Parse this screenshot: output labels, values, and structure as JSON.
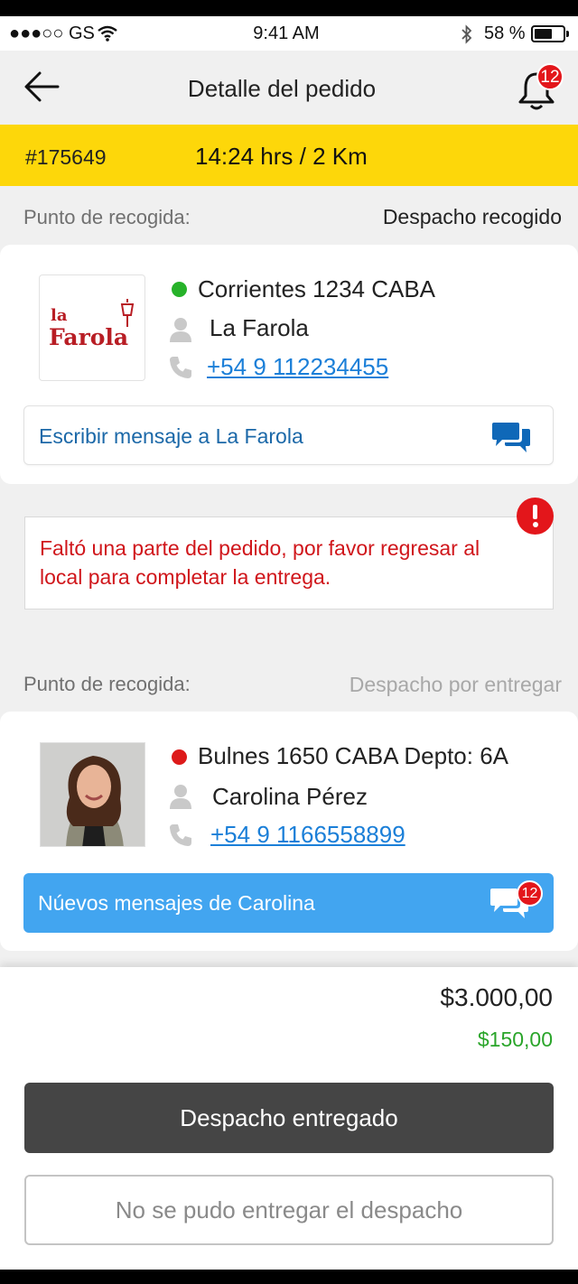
{
  "status_bar": {
    "carrier": "●●●○○ GS",
    "time": "9:41 AM",
    "battery": "58 %"
  },
  "header": {
    "title": "Detalle del pedido",
    "notification_count": "12",
    "back_icon": "arrow-left-icon",
    "bell_icon": "bell-icon"
  },
  "order_bar": {
    "order_id": "#175649",
    "eta": "14:24 hrs / 2 Km"
  },
  "pickup": {
    "label": "Punto de recogida:",
    "status": "Despacho recogido",
    "logo_small": "la",
    "logo_big": "Farola",
    "address": "Corrientes 1234 CABA",
    "name": "La Farola",
    "phone": "+54 9 112234455",
    "message_label": "Escribir mensaje a La Farola",
    "dot_color": "#27b22a"
  },
  "alert": {
    "text": "Faltó una parte del pedido, por favor regresar al local para completar la entrega."
  },
  "delivery": {
    "label": "Punto de recogida:",
    "status": "Despacho por entregar",
    "address": "Bulnes 1650 CABA Depto: 6A",
    "name": "Carolina Pérez",
    "phone": "+54 9 1166558899",
    "message_label": "Núevos mensajes de Carolina",
    "message_count": "12",
    "dot_color": "#dd1a1a"
  },
  "totals": {
    "amount": "$3.000,00",
    "fee": "$150,00"
  },
  "actions": {
    "delivered_label": "Despacho entregado",
    "failed_label": "No se pudo entregar el despacho"
  },
  "colors": {
    "accent_yellow": "#fdd70a",
    "link_blue": "#1b7fd8",
    "message_blue": "#42a5f0",
    "alert_red": "#d0161b",
    "fee_green": "#2aa52a",
    "primary_button": "#454545"
  }
}
